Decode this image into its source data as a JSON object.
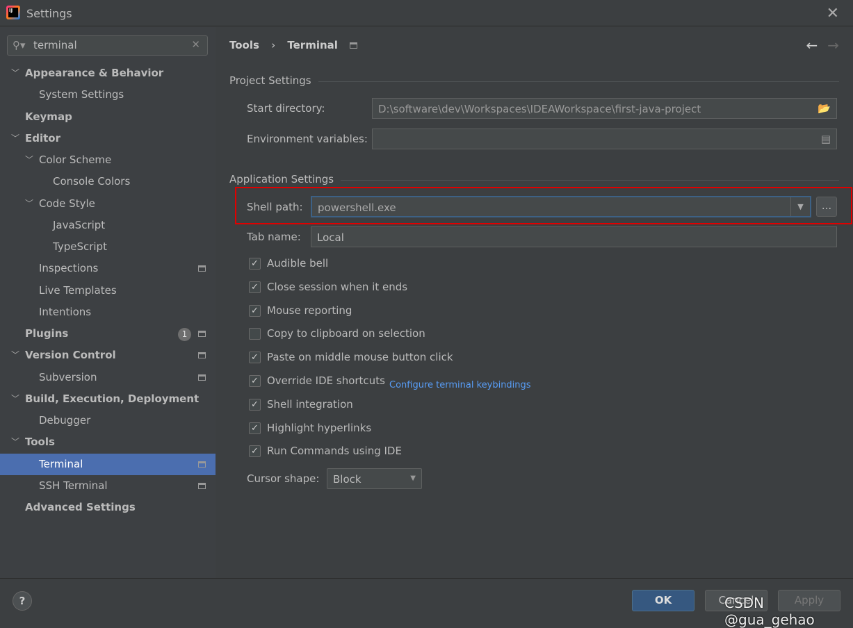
{
  "window": {
    "title": "Settings"
  },
  "sidebar": {
    "search": "terminal",
    "items": [
      {
        "label": "Appearance & Behavior",
        "level": 0,
        "bold": true,
        "expanded": true
      },
      {
        "label": "System Settings",
        "level": 1
      },
      {
        "label": "Keymap",
        "level": 0,
        "bold": true
      },
      {
        "label": "Editor",
        "level": 0,
        "bold": true,
        "expanded": true
      },
      {
        "label": "Color Scheme",
        "level": 1,
        "expanded": true
      },
      {
        "label": "Console Colors",
        "level": 2
      },
      {
        "label": "Code Style",
        "level": 1,
        "expanded": true
      },
      {
        "label": "JavaScript",
        "level": 2
      },
      {
        "label": "TypeScript",
        "level": 2
      },
      {
        "label": "Inspections",
        "level": 1,
        "page": true
      },
      {
        "label": "Live Templates",
        "level": 1
      },
      {
        "label": "Intentions",
        "level": 1
      },
      {
        "label": "Plugins",
        "level": 0,
        "bold": true,
        "page": true,
        "badge": "1"
      },
      {
        "label": "Version Control",
        "level": 0,
        "bold": true,
        "expanded": true,
        "page": true
      },
      {
        "label": "Subversion",
        "level": 1,
        "page": true
      },
      {
        "label": "Build, Execution, Deployment",
        "level": 0,
        "bold": true,
        "expanded": true
      },
      {
        "label": "Debugger",
        "level": 1
      },
      {
        "label": "Tools",
        "level": 0,
        "bold": true,
        "expanded": true
      },
      {
        "label": "Terminal",
        "level": 1,
        "page": true,
        "selected": true
      },
      {
        "label": "SSH Terminal",
        "level": 1,
        "page": true
      },
      {
        "label": "Advanced Settings",
        "level": 0,
        "bold": true
      }
    ]
  },
  "breadcrumb": {
    "parent": "Tools",
    "sep": "›",
    "current": "Terminal"
  },
  "project": {
    "title": "Project Settings",
    "start_dir_label": "Start directory:",
    "start_dir": "D:\\software\\dev\\Workspaces\\IDEAWorkspace\\first-java-project",
    "env_label": "Environment variables:",
    "env": ""
  },
  "app": {
    "title": "Application Settings",
    "shell_label": "Shell path:",
    "shell": "powershell.exe",
    "browse": "...",
    "tab_label": "Tab name:",
    "tab": "Local",
    "checks": [
      {
        "label": "Audible bell",
        "checked": true
      },
      {
        "label": "Close session when it ends",
        "checked": true
      },
      {
        "label": "Mouse reporting",
        "checked": true
      },
      {
        "label": "Copy to clipboard on selection",
        "checked": false
      },
      {
        "label": "Paste on middle mouse button click",
        "checked": true
      },
      {
        "label": "Override IDE shortcuts",
        "checked": true
      },
      {
        "label": "Shell integration",
        "checked": true
      },
      {
        "label": "Highlight hyperlinks",
        "checked": true
      },
      {
        "label": "Run Commands using IDE",
        "checked": true
      }
    ],
    "keybind_link": "Configure terminal keybindings",
    "cursor_label": "Cursor shape:",
    "cursor": "Block"
  },
  "footer": {
    "help": "?",
    "ok": "OK",
    "cancel": "Cancel",
    "apply": "Apply"
  },
  "watermark": "CSDN @gua_gehao",
  "colors": {
    "selection": "#4b6eaf",
    "link": "#589df6",
    "highlight": "#e00000"
  }
}
